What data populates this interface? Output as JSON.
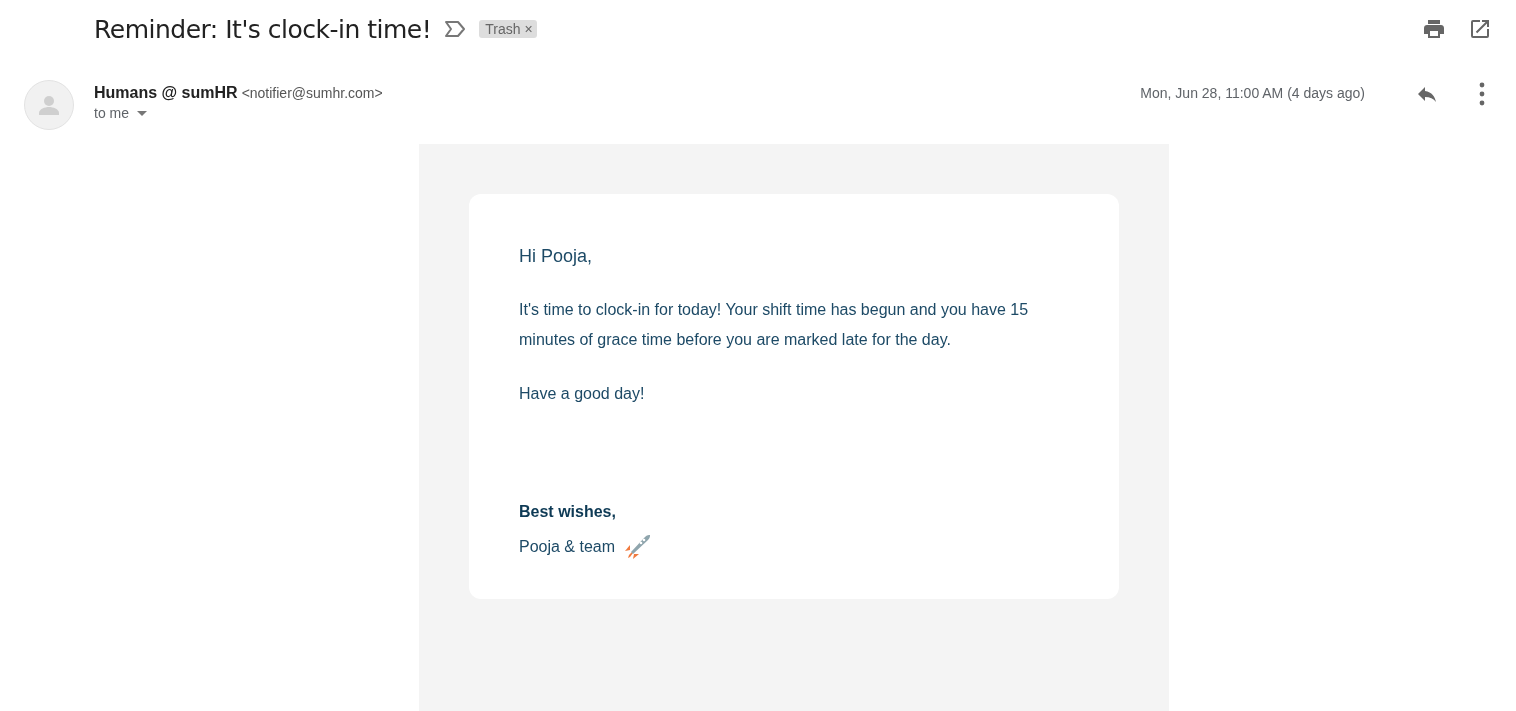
{
  "subject": "Reminder: It's clock-in time!",
  "label": {
    "text": "Trash",
    "close": "×"
  },
  "sender": {
    "name": "Humans @ sumHR",
    "email": "<notifier@sumhr.com>"
  },
  "recipient": "to me",
  "date": "Mon, Jun 28, 11:00 AM (4 days ago)",
  "body": {
    "greeting": "Hi Pooja,",
    "paragraphs": [
      "It's time to clock-in for today! Your shift time has begun and you have 15 minutes of grace time before you are marked late for the day.",
      "Have a good day!"
    ],
    "signoff": "Best wishes,",
    "signature": "Pooja & team"
  }
}
